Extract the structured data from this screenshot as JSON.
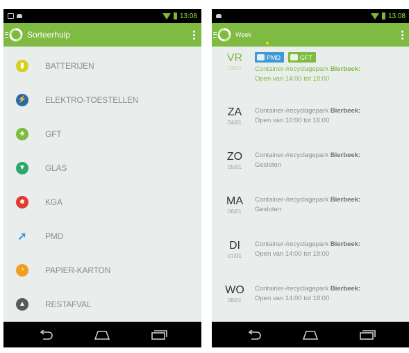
{
  "colors": {
    "accent": "#7fba42",
    "pmd_blue": "#3d9ad6",
    "background": "#e9eeec"
  },
  "status_bar": {
    "left_time": "13:08",
    "right_time": "13:08"
  },
  "left_screen": {
    "title": "Sorteerhulp",
    "categories": [
      {
        "label": "BATTERIJEN",
        "icon": "battery-icon",
        "color": "#d6cf1f"
      },
      {
        "label": "ELEKTRO-TOESTELLEN",
        "icon": "electronics-icon",
        "color": "#2a6ba6"
      },
      {
        "label": "GFT",
        "icon": "gft-icon",
        "color": "#7fba42"
      },
      {
        "label": "GLAS",
        "icon": "glass-icon",
        "color": "#2fa66c"
      },
      {
        "label": "KGA",
        "icon": "kga-icon",
        "color": "#e03b2e"
      },
      {
        "label": "PMD",
        "icon": "pmd-icon",
        "color": "#3d9ad6"
      },
      {
        "label": "PAPIER-KARTON",
        "icon": "paper-icon",
        "color": "#f0a020"
      },
      {
        "label": "RESTAFVAL",
        "icon": "restafval-icon",
        "color": "#555b5a"
      }
    ]
  },
  "right_screen": {
    "title": "Week",
    "days": [
      {
        "day": "VR",
        "date": "03/01",
        "tags": [
          "PMD",
          "GFT"
        ],
        "location": "Container-/recyclagepark",
        "city": "Bierbeek:",
        "status": "Open van 14:00 tot 18:00"
      },
      {
        "day": "ZA",
        "date": "04/01",
        "tags": [],
        "location": "Container-/recyclagepark",
        "city": "Bierbeek:",
        "status": "Open van 10:00 tot 16:00"
      },
      {
        "day": "ZO",
        "date": "05/01",
        "tags": [],
        "location": "Container-/recyclagepark",
        "city": "Bierbeek:",
        "status": "Gesloten"
      },
      {
        "day": "MA",
        "date": "06/01",
        "tags": [],
        "location": "Container-/recyclagepark",
        "city": "Bierbeek:",
        "status": "Gesloten"
      },
      {
        "day": "DI",
        "date": "07/01",
        "tags": [],
        "location": "Container-/recyclagepark",
        "city": "Bierbeek:",
        "status": "Open van 14:00 tot 18:00"
      },
      {
        "day": "WO",
        "date": "08/01",
        "tags": [],
        "location": "Container-/recyclagepark",
        "city": "Bierbeek:",
        "status": "Open van 14:00 tot 18:00"
      }
    ]
  },
  "nav_icons": [
    "back-icon",
    "home-icon",
    "recent-apps-icon"
  ]
}
